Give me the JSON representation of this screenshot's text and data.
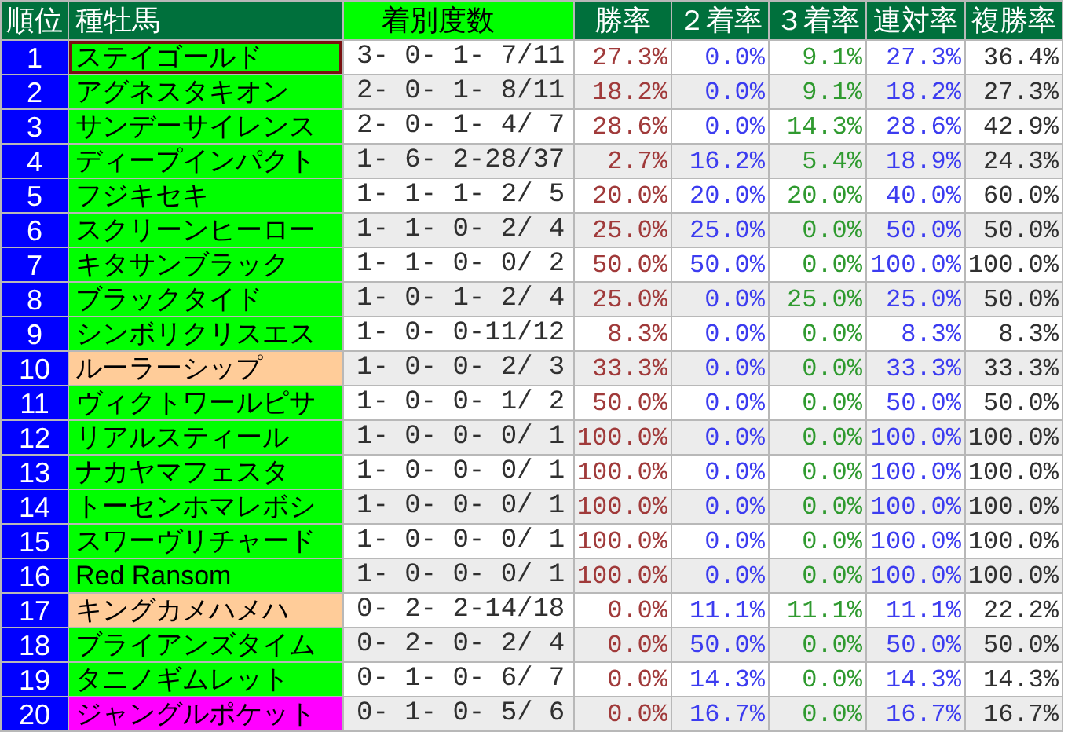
{
  "columns": [
    {
      "label": "順位",
      "kind": "rank"
    },
    {
      "label": "種牡馬",
      "kind": "name"
    },
    {
      "label": "着別度数",
      "kind": "record"
    },
    {
      "label": "勝率",
      "kind": "rate"
    },
    {
      "label": "２着率",
      "kind": "rate"
    },
    {
      "label": "３着率",
      "kind": "rate"
    },
    {
      "label": "連対率",
      "kind": "rate"
    },
    {
      "label": "複勝率",
      "kind": "rate"
    }
  ],
  "rows": [
    {
      "rank": "1",
      "name": "ステイゴールド",
      "color": "#00ff00",
      "selected": true,
      "record": "3- 0- 1- 7/11",
      "rates": [
        "27.3%",
        "0.0%",
        "9.1%",
        "27.3%",
        "36.4%"
      ]
    },
    {
      "rank": "2",
      "name": "アグネスタキオン",
      "color": "#00ff00",
      "selected": false,
      "record": "2- 0- 1- 8/11",
      "rates": [
        "18.2%",
        "0.0%",
        "9.1%",
        "18.2%",
        "27.3%"
      ]
    },
    {
      "rank": "3",
      "name": "サンデーサイレンス",
      "color": "#00ff00",
      "selected": false,
      "record": "2- 0- 1- 4/ 7",
      "rates": [
        "28.6%",
        "0.0%",
        "14.3%",
        "28.6%",
        "42.9%"
      ]
    },
    {
      "rank": "4",
      "name": "ディープインパクト",
      "color": "#00ff00",
      "selected": false,
      "record": "1- 6- 2-28/37",
      "rates": [
        "2.7%",
        "16.2%",
        "5.4%",
        "18.9%",
        "24.3%"
      ]
    },
    {
      "rank": "5",
      "name": "フジキセキ",
      "color": "#00ff00",
      "selected": false,
      "record": "1- 1- 1- 2/ 5",
      "rates": [
        "20.0%",
        "20.0%",
        "20.0%",
        "40.0%",
        "60.0%"
      ]
    },
    {
      "rank": "6",
      "name": "スクリーンヒーロー",
      "color": "#00ff00",
      "selected": false,
      "record": "1- 1- 0- 2/ 4",
      "rates": [
        "25.0%",
        "25.0%",
        "0.0%",
        "50.0%",
        "50.0%"
      ]
    },
    {
      "rank": "7",
      "name": "キタサンブラック",
      "color": "#00ff00",
      "selected": false,
      "record": "1- 1- 0- 0/ 2",
      "rates": [
        "50.0%",
        "50.0%",
        "0.0%",
        "100.0%",
        "100.0%"
      ]
    },
    {
      "rank": "8",
      "name": "ブラックタイド",
      "color": "#00ff00",
      "selected": false,
      "record": "1- 0- 1- 2/ 4",
      "rates": [
        "25.0%",
        "0.0%",
        "25.0%",
        "25.0%",
        "50.0%"
      ]
    },
    {
      "rank": "9",
      "name": "シンボリクリスエス",
      "color": "#00ff00",
      "selected": false,
      "record": "1- 0- 0-11/12",
      "rates": [
        "8.3%",
        "0.0%",
        "0.0%",
        "8.3%",
        "8.3%"
      ]
    },
    {
      "rank": "10",
      "name": "ルーラーシップ",
      "color": "#ffcc99",
      "selected": false,
      "record": "1- 0- 0- 2/ 3",
      "rates": [
        "33.3%",
        "0.0%",
        "0.0%",
        "33.3%",
        "33.3%"
      ]
    },
    {
      "rank": "11",
      "name": "ヴィクトワールピサ",
      "color": "#00ff00",
      "selected": false,
      "record": "1- 0- 0- 1/ 2",
      "rates": [
        "50.0%",
        "0.0%",
        "0.0%",
        "50.0%",
        "50.0%"
      ]
    },
    {
      "rank": "12",
      "name": "リアルスティール",
      "color": "#00ff00",
      "selected": false,
      "record": "1- 0- 0- 0/ 1",
      "rates": [
        "100.0%",
        "0.0%",
        "0.0%",
        "100.0%",
        "100.0%"
      ]
    },
    {
      "rank": "13",
      "name": "ナカヤマフェスタ",
      "color": "#00ff00",
      "selected": false,
      "record": "1- 0- 0- 0/ 1",
      "rates": [
        "100.0%",
        "0.0%",
        "0.0%",
        "100.0%",
        "100.0%"
      ]
    },
    {
      "rank": "14",
      "name": "トーセンホマレボシ",
      "color": "#00ff00",
      "selected": false,
      "record": "1- 0- 0- 0/ 1",
      "rates": [
        "100.0%",
        "0.0%",
        "0.0%",
        "100.0%",
        "100.0%"
      ]
    },
    {
      "rank": "15",
      "name": "スワーヴリチャード",
      "color": "#00ff00",
      "selected": false,
      "record": "1- 0- 0- 0/ 1",
      "rates": [
        "100.0%",
        "0.0%",
        "0.0%",
        "100.0%",
        "100.0%"
      ]
    },
    {
      "rank": "16",
      "name": "Red Ransom",
      "color": "#00ff00",
      "selected": false,
      "record": "1- 0- 0- 0/ 1",
      "rates": [
        "100.0%",
        "0.0%",
        "0.0%",
        "100.0%",
        "100.0%"
      ]
    },
    {
      "rank": "17",
      "name": "キングカメハメハ",
      "color": "#ffcc99",
      "selected": false,
      "record": "0- 2- 2-14/18",
      "rates": [
        "0.0%",
        "11.1%",
        "11.1%",
        "11.1%",
        "22.2%"
      ]
    },
    {
      "rank": "18",
      "name": "ブライアンズタイム",
      "color": "#00ff00",
      "selected": false,
      "record": "0- 2- 0- 2/ 4",
      "rates": [
        "0.0%",
        "50.0%",
        "0.0%",
        "50.0%",
        "50.0%"
      ]
    },
    {
      "rank": "19",
      "name": "タニノギムレット",
      "color": "#00ff00",
      "selected": false,
      "record": "0- 1- 0- 6/ 7",
      "rates": [
        "0.0%",
        "14.3%",
        "0.0%",
        "14.3%",
        "14.3%"
      ]
    },
    {
      "rank": "20",
      "name": "ジャングルポケット",
      "color": "#ff00ff",
      "selected": false,
      "record": "0- 1- 0- 5/ 6",
      "rates": [
        "0.0%",
        "16.7%",
        "0.0%",
        "16.7%",
        "16.7%"
      ]
    }
  ]
}
